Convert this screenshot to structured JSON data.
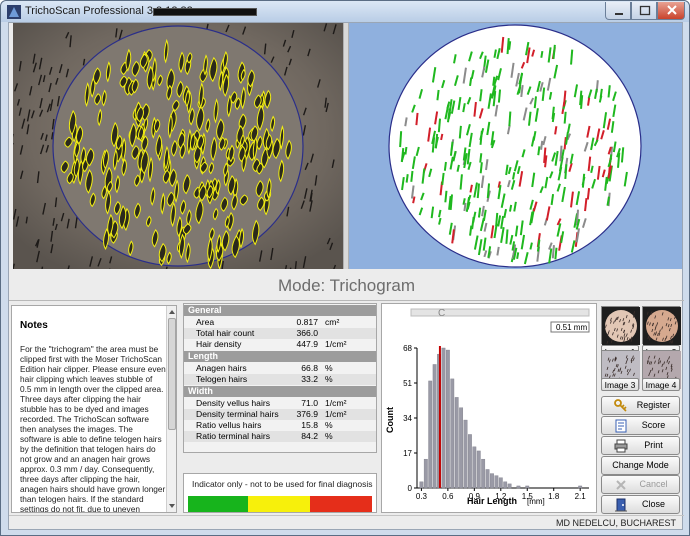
{
  "window": {
    "title": "TrichoScan Professional 3.2.12.82"
  },
  "mode": {
    "title": "Mode: Trichogram"
  },
  "notes": {
    "title": "Notes",
    "body": "For the \"trichogram\" the area must be clipped first with the Moser TrichoScan Edition hair clipper. Please ensure even hair clipping which leaves stubble of 0.5 mm in length over the clipped area. Three days after clipping the hair stubble has to be dyed and images recorded. The TrichoScan software then analyses the images. The software is able to define telogen hairs by the definition that telogen hairs do not grow and an anagen hair grows approx. 0.3 mm / day. Consequently, three days after clipping the hair, anagen hairs should have grown longer than telogen hairs. If the standard settings do not fit, due to uneven clipping, the length ruler can be used to set the length of hair the software should"
  },
  "results": {
    "sections": [
      {
        "title": "General",
        "rows": [
          {
            "label": "Area",
            "value": "0.817",
            "unit": "cm²"
          },
          {
            "label": "Total hair count",
            "value": "366.0",
            "unit": ""
          },
          {
            "label": "Hair density",
            "value": "447.9",
            "unit": "1/cm²"
          }
        ]
      },
      {
        "title": "Length",
        "rows": [
          {
            "label": "Anagen hairs",
            "value": "66.8",
            "unit": "%"
          },
          {
            "label": "Telogen hairs",
            "value": "33.2",
            "unit": "%"
          }
        ]
      },
      {
        "title": "Width",
        "rows": [
          {
            "label": "Density vellus hairs",
            "value": "71.0",
            "unit": "1/cm²"
          },
          {
            "label": "Density terminal hairs",
            "value": "376.9",
            "unit": "1/cm²"
          },
          {
            "label": "Ratio vellus hairs",
            "value": "15.8",
            "unit": "%"
          },
          {
            "label": "Ratio terminal hairs",
            "value": "84.2",
            "unit": "%"
          }
        ]
      }
    ]
  },
  "indicator": {
    "text": "Indicator only - not to be used for final diagnosis",
    "colors": [
      "#17b41c",
      "#f7f00b",
      "#e52e1a"
    ]
  },
  "histogram": {
    "slider_label": "C",
    "cutoff_label": "0.51 mm",
    "ylabel": "Count",
    "xlabel": "Hair Length",
    "xunit": "[mm]",
    "yticks": [
      "68",
      "51",
      "34",
      "17",
      "0"
    ],
    "xticks": [
      "0.3",
      "0.6",
      "0.9",
      "1.2",
      "1.5",
      "1.8",
      "2.1"
    ]
  },
  "chart_data": {
    "type": "bar",
    "title": "",
    "xlabel": "Hair Length [mm]",
    "ylabel": "Count",
    "ylim": [
      0,
      68
    ],
    "xlim": [
      0.25,
      2.2
    ],
    "bin_width": 0.05,
    "x": [
      0.3,
      0.35,
      0.4,
      0.45,
      0.5,
      0.55,
      0.6,
      0.65,
      0.7,
      0.75,
      0.8,
      0.85,
      0.9,
      0.95,
      1.0,
      1.05,
      1.1,
      1.15,
      1.2,
      1.25,
      1.3,
      1.35,
      1.4,
      1.45,
      1.5,
      1.55,
      1.6,
      1.65,
      1.7,
      1.75,
      1.8,
      1.85,
      1.9,
      1.95,
      2.0,
      2.05,
      2.1
    ],
    "values": [
      3,
      14,
      52,
      60,
      65,
      68,
      67,
      53,
      44,
      39,
      33,
      26,
      20,
      18,
      14,
      9,
      7,
      6,
      5,
      3,
      2,
      0,
      1,
      0,
      1,
      0,
      0,
      0,
      0,
      0,
      0,
      0,
      0,
      0,
      0,
      0,
      1
    ],
    "cutoff": 0.51,
    "cutoff_color": "#c40000",
    "bar_color": "#9a9aa6"
  },
  "side": {
    "thumbs": [
      {
        "label": "Image 1",
        "tone": "#e2c7b5"
      },
      {
        "label": "Image 2",
        "tone": "#d6a98f"
      },
      {
        "label": "Image 3",
        "tone": "#bfbcc3"
      },
      {
        "label": "Image 4",
        "tone": "#b4a8ad"
      }
    ],
    "buttons": [
      {
        "name": "register-button",
        "label": "Register",
        "icon": "key-icon",
        "enabled": true
      },
      {
        "name": "score-button",
        "label": "Score",
        "icon": "score-sheet-icon",
        "enabled": true
      },
      {
        "name": "print-button",
        "label": "Print",
        "icon": "printer-icon",
        "enabled": true
      },
      {
        "name": "change-mode-button",
        "label": "Change Mode",
        "icon": "",
        "enabled": true
      },
      {
        "name": "cancel-button",
        "label": "Cancel",
        "icon": "x-icon",
        "enabled": false
      },
      {
        "name": "close-button",
        "label": "Close",
        "icon": "door-exit-icon",
        "enabled": true
      }
    ]
  },
  "footer": {
    "text": "MD NEDELCU, BUCHAREST"
  }
}
